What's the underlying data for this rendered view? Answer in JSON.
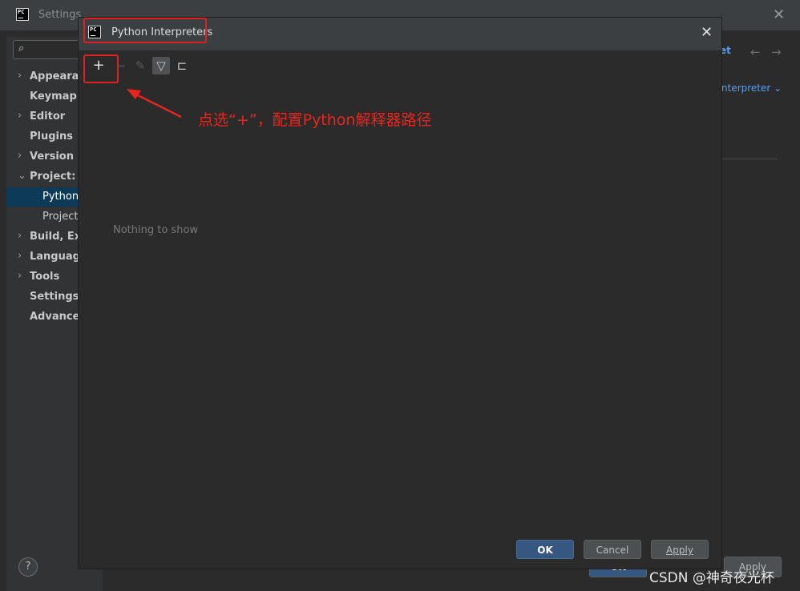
{
  "outer": {
    "title": "Settings",
    "logo_text": "PC",
    "tree": [
      {
        "label": "Appearance",
        "arrow": "›"
      },
      {
        "label": "Keymap",
        "arrow": ""
      },
      {
        "label": "Editor",
        "arrow": "›"
      },
      {
        "label": "Plugins",
        "arrow": ""
      },
      {
        "label": "Version Co",
        "arrow": "›"
      },
      {
        "label": "Project: py",
        "arrow": "⌄"
      },
      {
        "label": "Python I",
        "arrow": ""
      },
      {
        "label": "Project S",
        "arrow": ""
      },
      {
        "label": "Build, Exec",
        "arrow": "›"
      },
      {
        "label": "Language",
        "arrow": "›"
      },
      {
        "label": "Tools",
        "arrow": "›"
      },
      {
        "label": "Settings S",
        "arrow": ""
      },
      {
        "label": "Advanced",
        "arrow": ""
      }
    ],
    "right_link": "et",
    "interpreter_dropdown": "nterpreter ⌄",
    "ok_label": "OK",
    "apply_label": "Apply",
    "help": "?"
  },
  "dialog": {
    "title": "Python Interpreters",
    "logo_text": "PC",
    "empty_text": "Nothing to show",
    "ok_label": "OK",
    "cancel_label": "Cancel",
    "apply_label": "Apply"
  },
  "annotation": "点选“+”，配置Python解释器路径",
  "watermark": "CSDN @神奇夜光杯",
  "colors": {
    "annotation_red": "#e8251d",
    "primary_button": "#365880",
    "selection": "#0d3a58"
  }
}
